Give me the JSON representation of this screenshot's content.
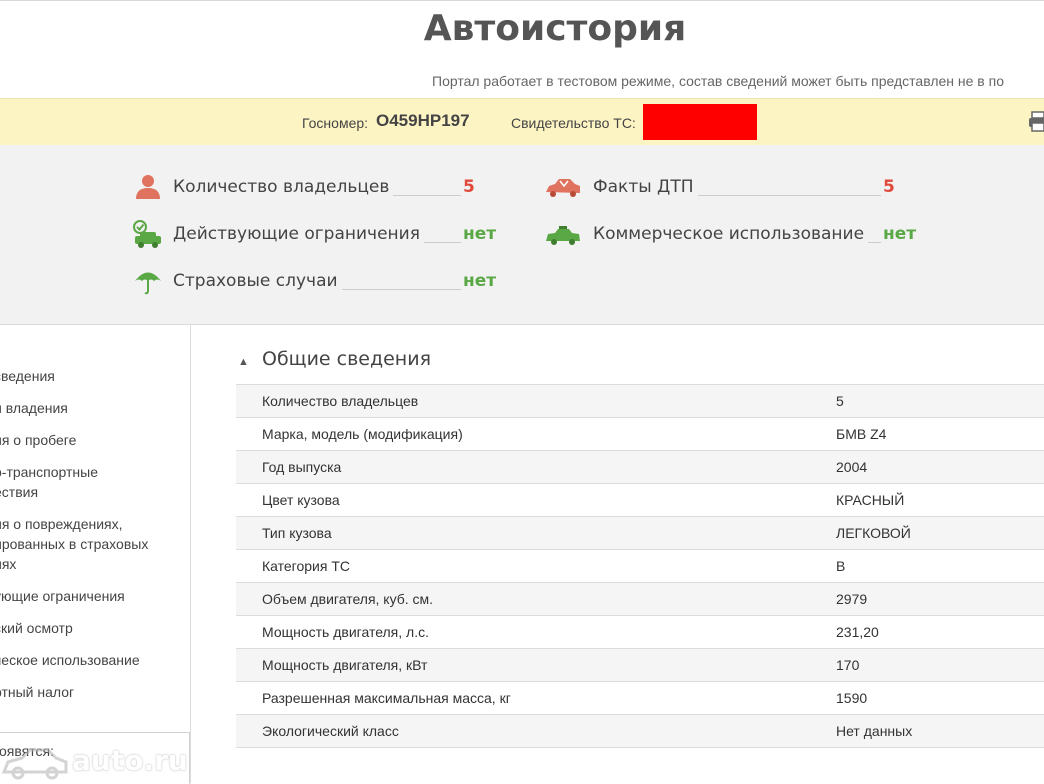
{
  "header": {
    "title": "Автоистория",
    "notice": "Портал работает в тестовом режиме, состав сведений может быть представлен не в по"
  },
  "plate_bar": {
    "plate_label": "Госномер:",
    "plate_value": "О459НР197",
    "cert_label": "Свидетельство ТС:",
    "cert_value_redacted_color": "#ff0000",
    "print_icon": "printer-icon"
  },
  "summary": {
    "owners": {
      "label": "Количество владельцев",
      "value": "5",
      "icon": "person-icon",
      "color": "#e04a3c"
    },
    "accidents": {
      "label": "Факты ДТП",
      "value": "5",
      "icon": "crashed-car-icon",
      "color": "#e04a3c"
    },
    "restrictions": {
      "label": "Действующие ограничения",
      "value": "нет",
      "icon": "car-check-icon",
      "color": "#5aa845"
    },
    "commercial": {
      "label": "Коммерческое использование",
      "value": "нет",
      "icon": "taxi-icon",
      "color": "#5aa845"
    },
    "insurance": {
      "label": "Страховые случаи",
      "value": "нет",
      "icon": "umbrella-icon",
      "color": "#5aa845"
    }
  },
  "sidebar": {
    "items": [
      {
        "label": "сведения"
      },
      {
        "label": "и владения"
      },
      {
        "label": "ия о пробеге"
      },
      {
        "label": "о-транспортные\nествия"
      },
      {
        "label": "ия о повреждениях,\nированных в страховых\nиях"
      },
      {
        "label": "ующие ограничения"
      },
      {
        "label": "ский осмотр"
      },
      {
        "label": "ческое использование"
      },
      {
        "label": "ртный налог"
      }
    ],
    "footer": "оявятся:"
  },
  "section": {
    "title": "Общие сведения",
    "rows": [
      {
        "key": "Количество владельцев",
        "value": "5"
      },
      {
        "key": "Марка, модель (модификация)",
        "value": "БМВ Z4"
      },
      {
        "key": "Год выпуска",
        "value": "2004"
      },
      {
        "key": "Цвет кузова",
        "value": "КРАСНЫЙ"
      },
      {
        "key": "Тип кузова",
        "value": "ЛЕГКОВОЙ"
      },
      {
        "key": "Категория ТС",
        "value": "B"
      },
      {
        "key": "Объем двигателя, куб. см.",
        "value": "2979"
      },
      {
        "key": "Мощность двигателя, л.с.",
        "value": "231,20"
      },
      {
        "key": "Мощность двигателя, кВт",
        "value": "170"
      },
      {
        "key": "Разрешенная максимальная масса, кг",
        "value": "1590"
      },
      {
        "key": "Экологический класс",
        "value": "Нет данных"
      }
    ]
  },
  "watermark": {
    "text": "auto.ru"
  }
}
